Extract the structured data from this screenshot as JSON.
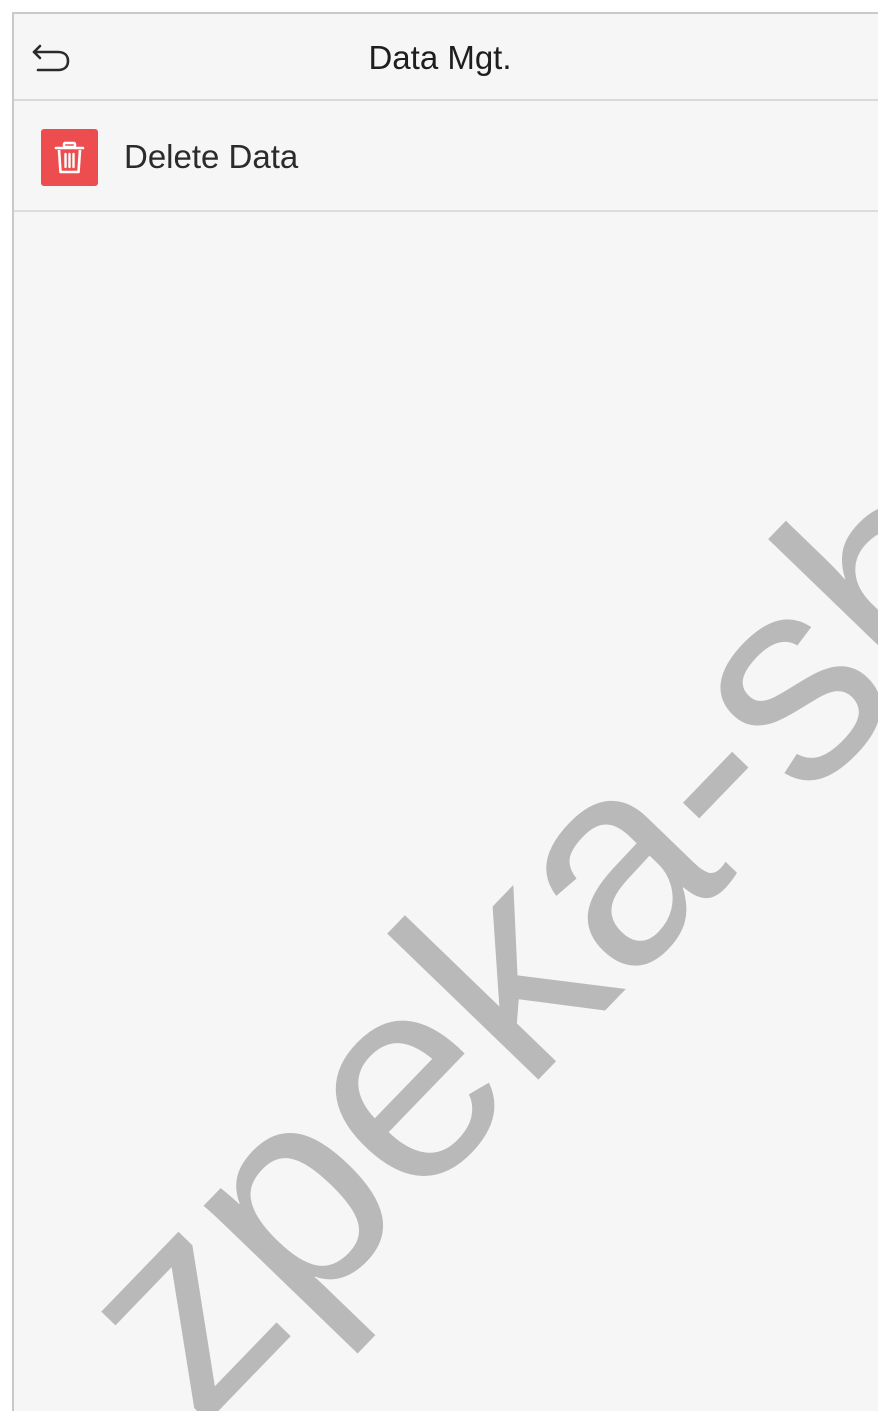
{
  "header": {
    "title": "Data Mgt.",
    "back_icon": "back-arrow-icon"
  },
  "menu": {
    "items": [
      {
        "label": "Delete Data",
        "icon": "trash-icon",
        "icon_color": "#ee4d4f"
      }
    ]
  },
  "watermark": {
    "text": "zpeka-shop",
    "color": "#b5b5b5"
  }
}
